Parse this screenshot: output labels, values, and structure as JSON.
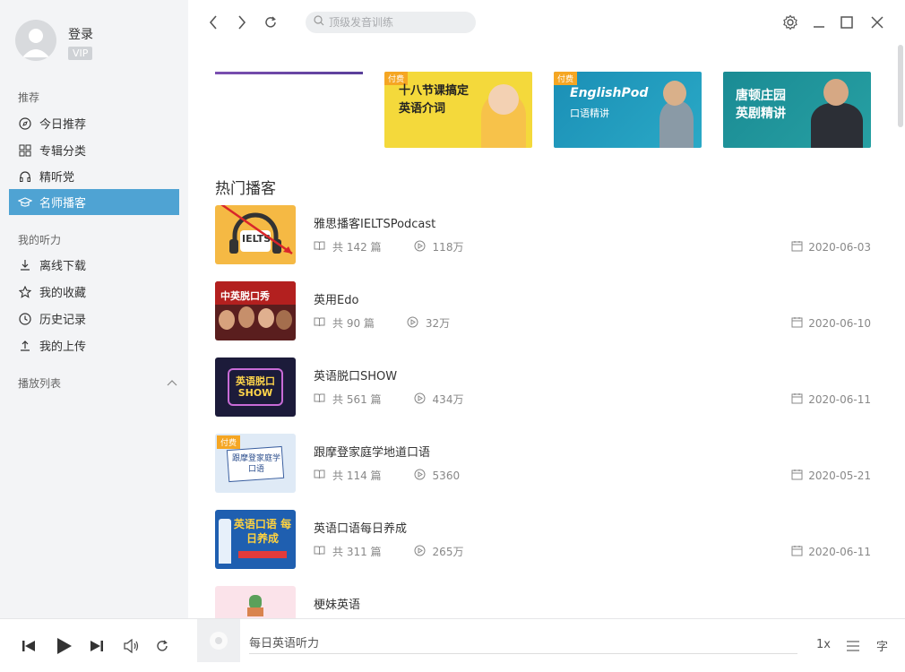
{
  "user": {
    "login": "登录",
    "vip": "VIP"
  },
  "sidebar": {
    "recommend_title": "推荐",
    "items": [
      {
        "label": "今日推荐",
        "icon": "compass-icon"
      },
      {
        "label": "专辑分类",
        "icon": "grid-icon"
      },
      {
        "label": "精听党",
        "icon": "headphones-icon"
      },
      {
        "label": "名师播客",
        "icon": "graduation-cap-icon",
        "active": true
      }
    ],
    "my_title": "我的听力",
    "my_items": [
      {
        "label": "离线下载",
        "icon": "download-icon"
      },
      {
        "label": "我的收藏",
        "icon": "star-icon"
      },
      {
        "label": "历史记录",
        "icon": "clock-icon"
      },
      {
        "label": "我的上传",
        "icon": "upload-icon"
      }
    ],
    "playlist_title": "播放列表"
  },
  "topbar": {
    "search_placeholder": "顶级发音训练"
  },
  "banners": [
    {
      "tag": "付费",
      "title_line1": "十八节课搞定",
      "title_line2": "英语介词"
    },
    {
      "tag": "付费",
      "title": "EnglishPod",
      "subtitle": "口语精讲"
    },
    {
      "title_line1": "唐顿庄园",
      "title_line2": "英剧精讲"
    }
  ],
  "main": {
    "section_title": "热门播客"
  },
  "podcasts": [
    {
      "name": "雅思播客IELTSPodcast",
      "count": "共 142 篇",
      "plays": "118万",
      "date": "2020-06-03",
      "thumb_text": "IELTS"
    },
    {
      "name": "英用Edo",
      "count": "共 90 篇",
      "plays": "32万",
      "date": "2020-06-10",
      "thumb_text": "中英脱口秀"
    },
    {
      "name": "英语脱口SHOW",
      "count": "共 561 篇",
      "plays": "434万",
      "date": "2020-06-11",
      "thumb_text": "英语脱口 SHOW"
    },
    {
      "name": "跟摩登家庭学地道口语",
      "count": "共 114 篇",
      "plays": "5360",
      "date": "2020-05-21",
      "tag": "付费",
      "thumb_text": "跟摩登家庭学口语"
    },
    {
      "name": "英语口语每日养成",
      "count": "共 311 篇",
      "plays": "265万",
      "date": "2020-06-11",
      "thumb_text": "英语口语 每日养成"
    },
    {
      "name": "梗妹英语"
    }
  ],
  "player": {
    "now_playing": "每日英语听力",
    "speed": "1x",
    "subtitle_btn": "字"
  },
  "colors": {
    "accent": "#4fa3d3",
    "sidebar_bg": "#f3f4f6"
  }
}
